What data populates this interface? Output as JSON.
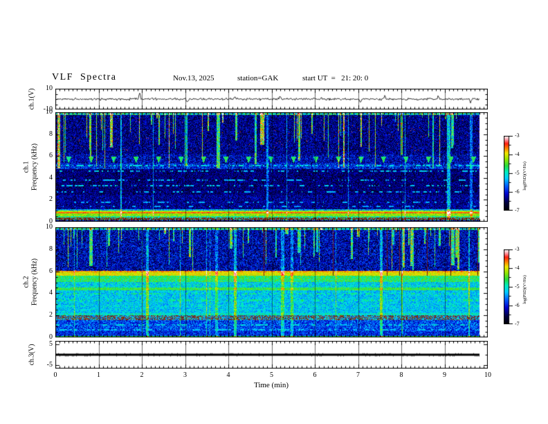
{
  "header": {
    "title": "VLF  Spectra",
    "date": "Nov.13, 2025",
    "station": "station=GAK",
    "start_ut": "start UT  =   21: 20: 0"
  },
  "xaxis": {
    "label": "Time  (min)",
    "ticks": [
      "0",
      "1",
      "2",
      "3",
      "4",
      "5",
      "6",
      "7",
      "8",
      "9",
      "10"
    ],
    "tick_values": [
      0,
      1,
      2,
      3,
      4,
      5,
      6,
      7,
      8,
      9,
      10
    ],
    "min": 0,
    "max": 10,
    "data_end": 9.8
  },
  "colorbar": {
    "label": "log(PSD)(V²/Hz)",
    "tick_labels": [
      "-3",
      "-4",
      "-5",
      "-6",
      "-7"
    ],
    "range": [
      -3,
      -7
    ]
  },
  "chart_data": [
    {
      "type": "line",
      "name": "ch.1 waveform",
      "ylabel": "ch.1(V)",
      "ylim": [
        -10,
        10
      ],
      "yticks": [
        10,
        -10
      ],
      "ytick_labels": [
        "10",
        "-10"
      ],
      "noise_amp_v": 1.1,
      "spikes": [
        {
          "t": 1.95,
          "a": 6.5
        },
        {
          "t": 3.05,
          "a": -2.6
        },
        {
          "t": 4.15,
          "a": 3.0
        },
        {
          "t": 5.2,
          "a": 2.2
        },
        {
          "t": 7.05,
          "a": -3.2
        },
        {
          "t": 7.62,
          "a": 3.1
        },
        {
          "t": 8.85,
          "a": 2.8
        },
        {
          "t": 9.6,
          "a": -3.6
        }
      ],
      "seed": 20251113
    },
    {
      "type": "heatmap",
      "name": "ch.1 spectrogram",
      "ylabel_lines": [
        "ch.1",
        "Frequency  (kHz)"
      ],
      "ylim": [
        0,
        10
      ],
      "yticks": [
        0,
        2,
        4,
        6,
        8,
        10
      ],
      "ytick_labels": [
        "0",
        "2",
        "4",
        "6",
        "8",
        "10"
      ],
      "bands": [
        {
          "f": [
            9.78,
            10.01
          ],
          "base": 0.5,
          "var": 0.22
        },
        {
          "f": [
            6.2,
            9.78
          ],
          "base": 0.16,
          "var": 0.13
        },
        {
          "f": [
            5.35,
            6.2
          ],
          "base": 0.2,
          "var": 0.14
        },
        {
          "f": [
            4.85,
            5.35
          ],
          "base": 0.26,
          "var": 0.15
        },
        {
          "f": [
            2.5,
            4.85
          ],
          "base": 0.14,
          "var": 0.11
        },
        {
          "f": [
            1.15,
            2.5
          ],
          "base": 0.17,
          "var": 0.11
        },
        {
          "f": [
            1.05,
            1.15
          ],
          "base": 0.42,
          "var": 0.15
        },
        {
          "f": [
            0.9,
            1.05
          ],
          "base": 0.7,
          "var": 0.07
        },
        {
          "f": [
            0.78,
            0.9
          ],
          "base": 0.85,
          "var": 0.05
        },
        {
          "f": [
            0.55,
            0.78
          ],
          "base": 0.68,
          "var": 0.08
        },
        {
          "f": [
            0.38,
            0.55
          ],
          "base": 0.55,
          "var": 0.13
        },
        {
          "f": [
            0.18,
            0.38
          ],
          "base": 0.5,
          "var": 0.1,
          "tint": [
            135,
            45,
            30
          ],
          "tint_mix": 0.75
        },
        {
          "f": [
            -0.01,
            0.18
          ],
          "base": 0.22,
          "var": 0.12
        }
      ],
      "hlines": [
        {
          "f": 5.15,
          "amp": 0.48,
          "p": 0.55,
          "hw": 0.07
        },
        {
          "f": 4.65,
          "amp": 0.44,
          "p": 0.4,
          "hw": 0.06
        },
        {
          "f": 3.85,
          "amp": 0.42,
          "p": 0.33,
          "hw": 0.06
        },
        {
          "f": 3.3,
          "amp": 0.44,
          "p": 0.36,
          "hw": 0.06
        },
        {
          "f": 2.75,
          "amp": 0.42,
          "p": 0.3,
          "hw": 0.06
        },
        {
          "f": 1.8,
          "amp": 0.4,
          "p": 0.26,
          "hw": 0.06
        },
        {
          "f": 1.4,
          "amp": 0.4,
          "p": 0.26,
          "hw": 0.06
        }
      ],
      "streaks": {
        "prob": 0.1,
        "cont": 0.45,
        "min_f": 4.9,
        "boost": 0.42,
        "full_prob": 0.012,
        "full_boost": 0.2
      },
      "specks": {
        "f": [
          6.5,
          9.7
        ],
        "prob": 0.0035,
        "amp": 0.86
      },
      "blobs": {
        "f_top": 6.0,
        "f_bot": 5.35,
        "period": 0.52,
        "phase": 0.3,
        "amp": 0.5,
        "halfw": 4
      },
      "seed": 1001
    },
    {
      "type": "heatmap",
      "name": "ch.2 spectrogram",
      "ylabel_lines": [
        "ch.2",
        "Frequency  (kHz)"
      ],
      "ylim": [
        0,
        10
      ],
      "yticks": [
        0,
        2,
        4,
        6,
        8,
        10
      ],
      "ytick_labels": [
        "0",
        "2",
        "4",
        "6",
        "8",
        "10"
      ],
      "bands": [
        {
          "f": [
            9.78,
            10.01
          ],
          "base": 0.5,
          "var": 0.2
        },
        {
          "f": [
            6.1,
            9.78
          ],
          "base": 0.2,
          "var": 0.15
        },
        {
          "f": [
            5.92,
            6.1
          ],
          "base": 0.8,
          "var": 0.08
        },
        {
          "f": [
            5.6,
            5.92
          ],
          "base": 0.75,
          "var": 0.07
        },
        {
          "f": [
            5.05,
            5.6
          ],
          "base": 0.58,
          "var": 0.1
        },
        {
          "f": [
            4.55,
            5.05
          ],
          "base": 0.46,
          "var": 0.12
        },
        {
          "f": [
            4.28,
            4.55
          ],
          "base": 0.6,
          "var": 0.08
        },
        {
          "f": [
            2.25,
            4.28
          ],
          "base": 0.44,
          "var": 0.11
        },
        {
          "f": [
            2.05,
            2.25
          ],
          "base": 0.5,
          "var": 0.1
        },
        {
          "f": [
            1.6,
            2.05
          ],
          "base": 0.42,
          "var": 0.12,
          "tint": [
            140,
            55,
            30
          ],
          "tint_mix": 0.5
        },
        {
          "f": [
            0.62,
            1.6
          ],
          "base": 0.3,
          "var": 0.13
        },
        {
          "f": [
            0.15,
            0.62
          ],
          "base": 0.26,
          "var": 0.12
        },
        {
          "f": [
            -0.01,
            0.15
          ],
          "base": 0.6,
          "var": 0.08
        }
      ],
      "hlines": [
        {
          "f": 4.0,
          "amp": 0.55,
          "p": 0.5,
          "hw": 0.07
        },
        {
          "f": 3.4,
          "amp": 0.54,
          "p": 0.45,
          "hw": 0.07
        },
        {
          "f": 2.85,
          "amp": 0.5,
          "p": 0.4,
          "hw": 0.06
        },
        {
          "f": 1.15,
          "amp": 0.48,
          "p": 0.4,
          "hw": 0.07
        },
        {
          "f": 0.75,
          "amp": 0.44,
          "p": 0.3,
          "hw": 0.06
        }
      ],
      "streaks": {
        "prob": 0.13,
        "cont": 0.5,
        "min_f": 6.1,
        "boost": 0.35,
        "full_prob": 0.02,
        "full_boost": 0.16
      },
      "specks": {
        "f": [
          5.92,
          6.12
        ],
        "prob": 0.06,
        "amp": 0.88
      },
      "dark_streaks": {
        "prob": 0.006,
        "f": [
          5.6,
          10
        ],
        "color": [
          120,
          30,
          25
        ]
      },
      "seed": 2002
    },
    {
      "type": "line",
      "name": "ch.3 waveform",
      "ylabel": "ch.3(V)",
      "ylim": [
        -6.7,
        6.7
      ],
      "yticks": [
        5,
        -5
      ],
      "ytick_labels": [
        "5",
        "-5"
      ],
      "flat_value": 0,
      "seed": 3003
    }
  ],
  "colormap": [
    [
      0.0,
      "#000005"
    ],
    [
      0.1,
      "#00003c"
    ],
    [
      0.22,
      "#0000cc"
    ],
    [
      0.33,
      "#0060ff"
    ],
    [
      0.43,
      "#00ccff"
    ],
    [
      0.52,
      "#00eebb"
    ],
    [
      0.6,
      "#28dc3c"
    ],
    [
      0.69,
      "#96e600"
    ],
    [
      0.77,
      "#f0e600"
    ],
    [
      0.84,
      "#ff7800"
    ],
    [
      0.9,
      "#ff1e14"
    ],
    [
      0.95,
      "#ff96a0"
    ],
    [
      1.0,
      "#ffffff"
    ]
  ]
}
